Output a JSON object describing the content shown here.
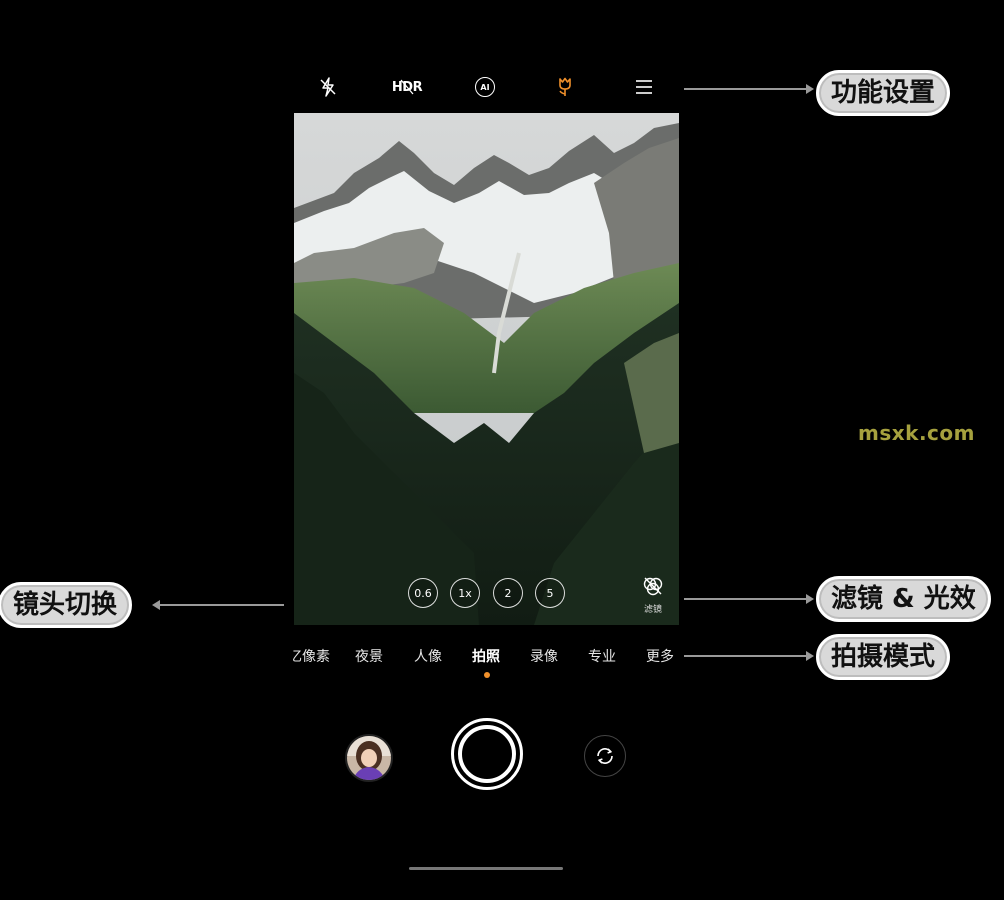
{
  "topbar": {
    "flash_icon": "flash-off-icon",
    "hdr_label": "HDR",
    "ai_label": "AI",
    "macro_icon": "tulip-icon",
    "menu_icon": "menu-icon",
    "accent_color": "#f0902b"
  },
  "zoom_levels": [
    "0.6",
    "1x",
    "2",
    "5"
  ],
  "filter_button": {
    "label": "滤镜",
    "icon": "filter-off-icon"
  },
  "modes": [
    "亿像素",
    "夜景",
    "人像",
    "拍照",
    "录像",
    "专业",
    "更多"
  ],
  "active_mode": "拍照",
  "callouts": {
    "settings": "功能设置",
    "lens_switch": "镜头切换",
    "filter_light": "滤镜 & 光效",
    "shoot_modes": "拍摄模式"
  },
  "watermark": "msxk.com"
}
